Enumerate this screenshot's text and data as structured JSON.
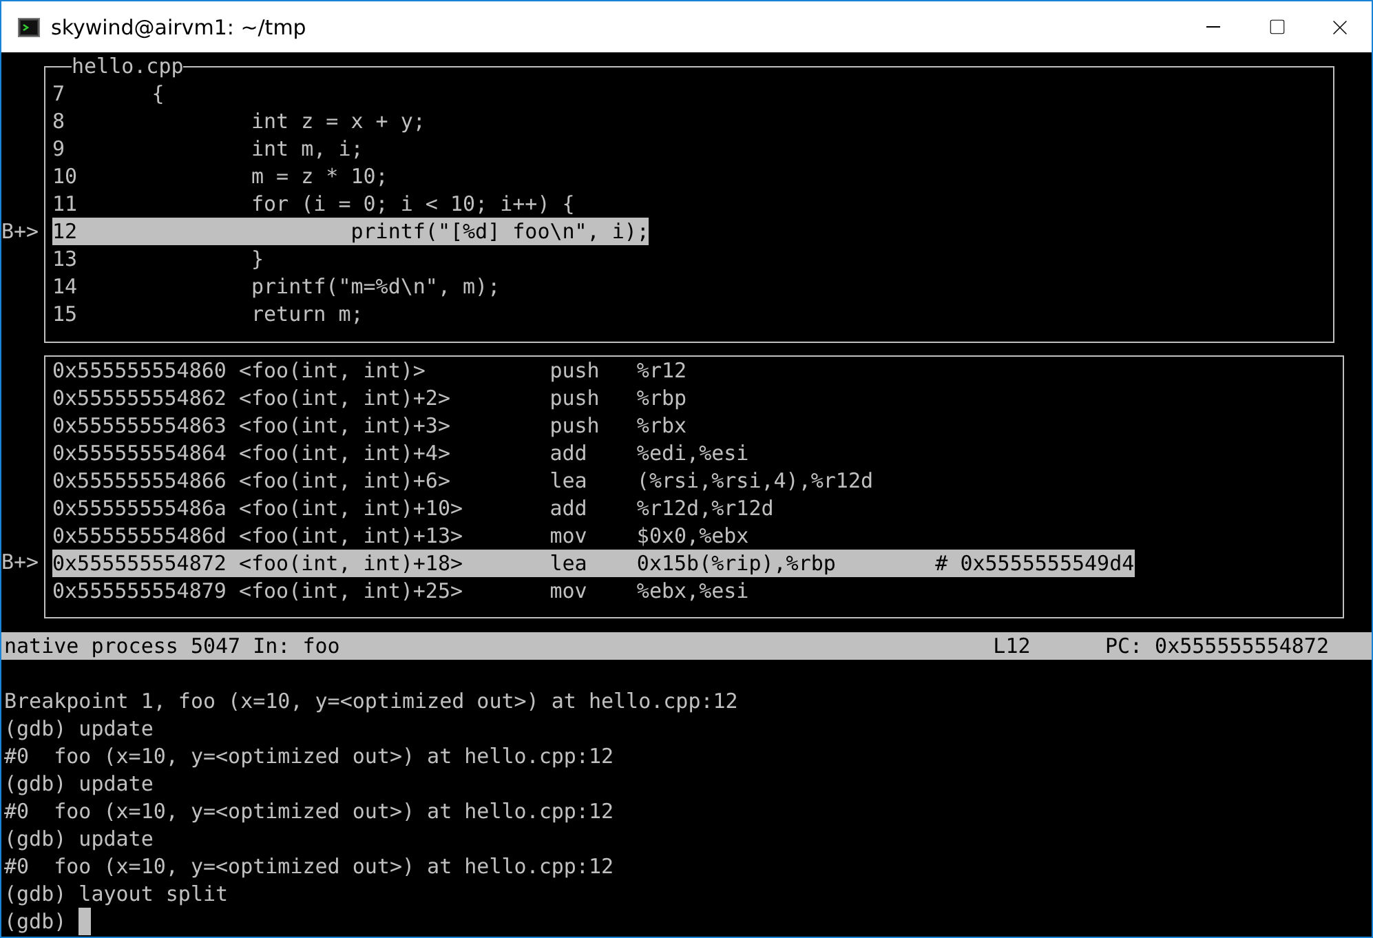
{
  "window": {
    "title": "skywind@airvm1: ~/tmp"
  },
  "source": {
    "title": "hello.cpp",
    "lines": [
      {
        "number": "7",
        "code": "{",
        "current": false
      },
      {
        "number": "8",
        "code": "        int z = x + y;",
        "current": false
      },
      {
        "number": "9",
        "code": "        int m, i;",
        "current": false
      },
      {
        "number": "10",
        "code": "        m = z * 10;",
        "current": false
      },
      {
        "number": "11",
        "code": "        for (i = 0; i < 10; i++) {",
        "current": false
      },
      {
        "number": "12",
        "code": "                printf(\"[%d] foo\\n\", i);",
        "current": true,
        "marker": "B+>"
      },
      {
        "number": "13",
        "code": "        }",
        "current": false
      },
      {
        "number": "14",
        "code": "        printf(\"m=%d\\n\", m);",
        "current": false
      },
      {
        "number": "15",
        "code": "        return m;",
        "current": false
      }
    ]
  },
  "disassembly": {
    "lines": [
      {
        "address": "0x555555554860",
        "symbol": "<foo(int, int)>",
        "mnemonic": "push",
        "operands": "%r12",
        "current": false
      },
      {
        "address": "0x555555554862",
        "symbol": "<foo(int, int)+2>",
        "mnemonic": "push",
        "operands": "%rbp",
        "current": false
      },
      {
        "address": "0x555555554863",
        "symbol": "<foo(int, int)+3>",
        "mnemonic": "push",
        "operands": "%rbx",
        "current": false
      },
      {
        "address": "0x555555554864",
        "symbol": "<foo(int, int)+4>",
        "mnemonic": "add",
        "operands": "%edi,%esi",
        "current": false
      },
      {
        "address": "0x555555554866",
        "symbol": "<foo(int, int)+6>",
        "mnemonic": "lea",
        "operands": "(%rsi,%rsi,4),%r12d",
        "current": false
      },
      {
        "address": "0x55555555486a",
        "symbol": "<foo(int, int)+10>",
        "mnemonic": "add",
        "operands": "%r12d,%r12d",
        "current": false
      },
      {
        "address": "0x55555555486d",
        "symbol": "<foo(int, int)+13>",
        "mnemonic": "mov",
        "operands": "$0x0,%ebx",
        "current": false
      },
      {
        "address": "0x555555554872",
        "symbol": "<foo(int, int)+18>",
        "mnemonic": "lea",
        "operands": "0x15b(%rip),%rbp",
        "comment": "# 0x5555555549d4",
        "current": true,
        "marker": "B+>"
      },
      {
        "address": "0x555555554879",
        "symbol": "<foo(int, int)+25>",
        "mnemonic": "mov",
        "operands": "%ebx,%esi",
        "current": false
      }
    ]
  },
  "status_bar": {
    "process": "native process 5047 In: foo",
    "line": "L12",
    "pc": "PC: 0x555555554872"
  },
  "console": {
    "lines": [
      "Breakpoint 1, foo (x=10, y=<optimized out>) at hello.cpp:12",
      "(gdb) update",
      "#0  foo (x=10, y=<optimized out>) at hello.cpp:12",
      "(gdb) update",
      "#0  foo (x=10, y=<optimized out>) at hello.cpp:12",
      "(gdb) update",
      "#0  foo (x=10, y=<optimized out>) at hello.cpp:12",
      "(gdb) layout split"
    ],
    "prompt": "(gdb)",
    "cursor": true
  }
}
